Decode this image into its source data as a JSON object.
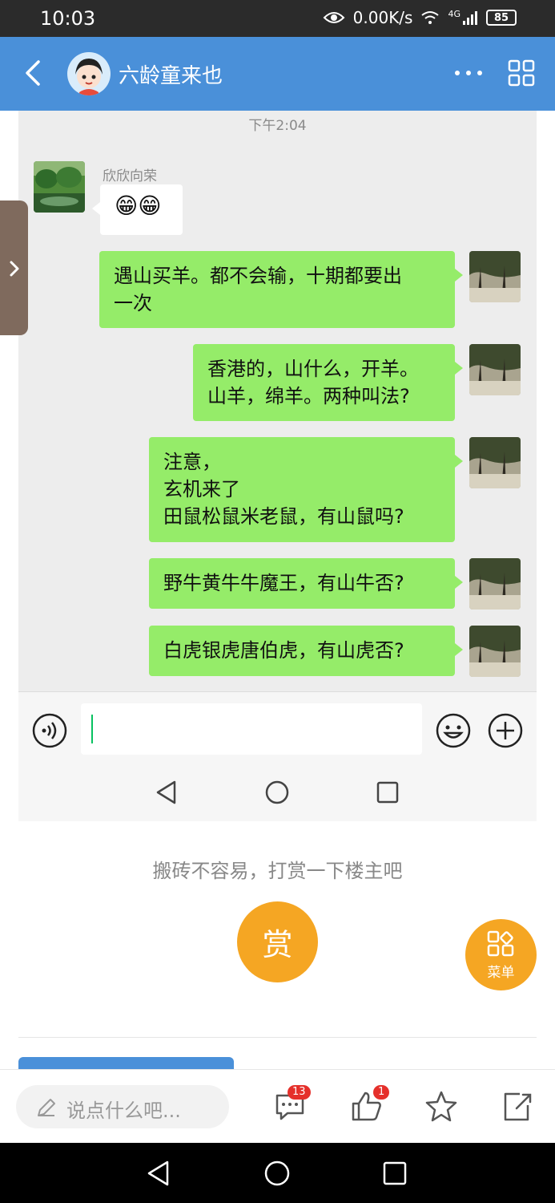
{
  "status_bar": {
    "time": "10:03",
    "net_speed": "0.00K/s",
    "network": "4G",
    "battery": "85"
  },
  "header": {
    "title": "六龄童来也"
  },
  "chat": {
    "timestamp": "下午2:04",
    "sender_name": "欣欣向荣",
    "incoming_emoji": "😁😁",
    "messages": [
      "遇山买羊。都不会输，十期都要出\n一次",
      "香港的，山什么，开羊。\n山羊，绵羊。两种叫法?",
      "注意，\n玄机来了\n田鼠松鼠米老鼠，有山鼠吗?",
      "野牛黄牛牛魔王，有山牛否?",
      "白虎银虎唐伯虎，有山虎否?"
    ]
  },
  "reward": {
    "prompt": "搬砖不容易，打赏一下楼主吧",
    "button": "赏"
  },
  "menu_fab": {
    "label": "菜单"
  },
  "bottom_bar": {
    "placeholder": "说点什么吧...",
    "comment_count": "13",
    "like_count": "1"
  },
  "colors": {
    "header": "#4a90d9",
    "my_bubble": "#95ec69",
    "accent": "#f5a623",
    "badge": "#e5302b"
  }
}
